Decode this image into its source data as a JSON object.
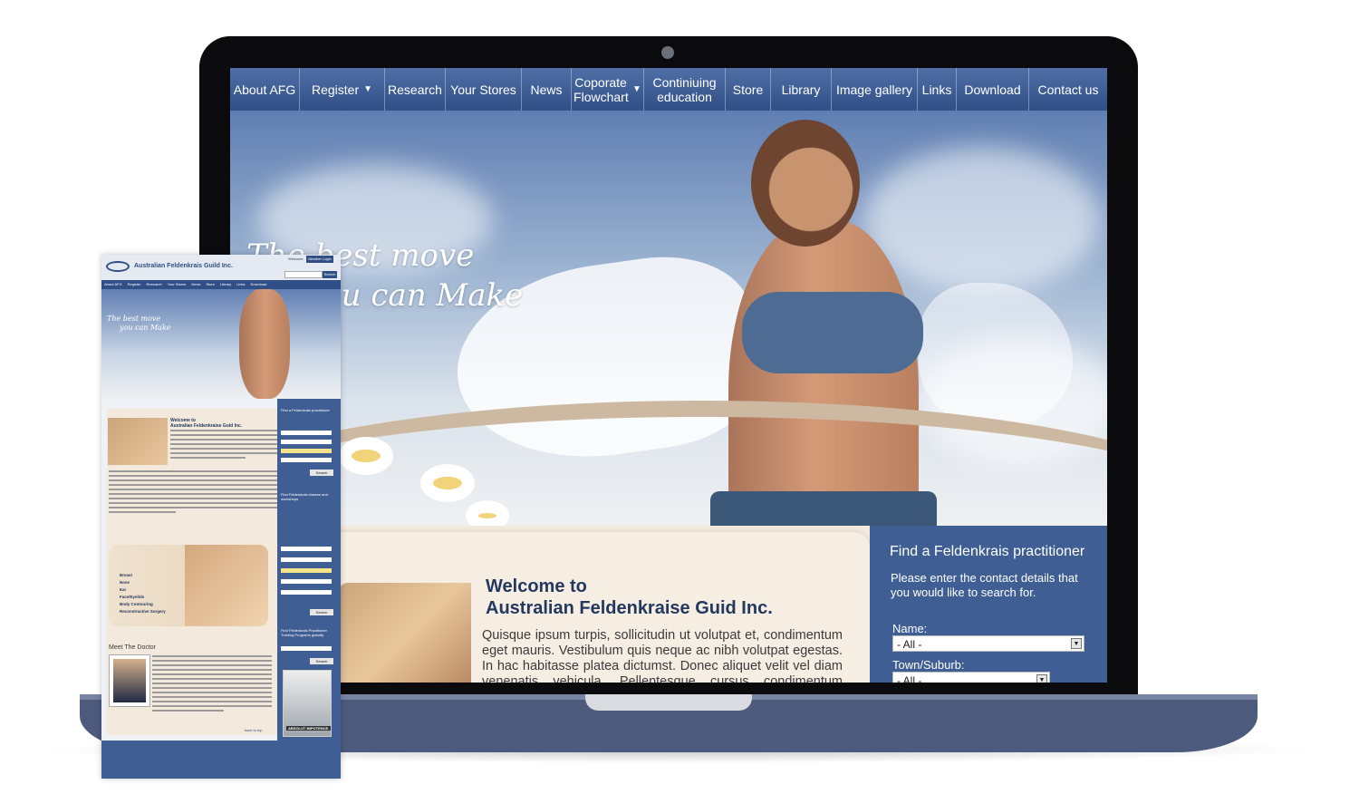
{
  "desktop": {
    "nav": [
      {
        "label": "About AFG",
        "dropdown": false
      },
      {
        "label": "Register",
        "dropdown": true
      },
      {
        "label": "Research",
        "dropdown": false
      },
      {
        "label": "Your Stores",
        "dropdown": false
      },
      {
        "label": "News",
        "dropdown": false
      },
      {
        "label": "Coporate Flowchart",
        "dropdown": true
      },
      {
        "label": "Continiuing education",
        "dropdown": false
      },
      {
        "label": "Store",
        "dropdown": false
      },
      {
        "label": "Library",
        "dropdown": false
      },
      {
        "label": "Image gallery",
        "dropdown": false
      },
      {
        "label": "Links",
        "dropdown": false
      },
      {
        "label": "Download",
        "dropdown": false
      },
      {
        "label": "Contact us",
        "dropdown": false
      }
    ],
    "hero": {
      "tagline_line1": "The best move",
      "tagline_line2": "you can Make"
    },
    "welcome": {
      "title_line1": "Welcome to",
      "title_line2": "Australian Feldenkraise Guid Inc.",
      "body": "Quisque ipsum turpis, sollicitudin ut volutpat et, condimentum eget mauris. Vestibulum quis neque ac nibh volutpat egestas. In hac habitasse platea dictumst. Donec aliquet velit vel diam venenatis vehicula. Pellentesque cursus condimentum tempus."
    },
    "sidebar": {
      "title": "Find a Feldenkrais practitioner",
      "description": "Please enter the contact details that you would like to search for.",
      "name_label": "Name:",
      "name_value": "- All -",
      "town_label": "Town/Suburb:",
      "town_value": "- All -"
    }
  },
  "mobile": {
    "site_name": "Australian Feldenkrais Guild Inc.",
    "welcome_text": "Welcome",
    "login_label": "Member Login",
    "search_label": "Search",
    "nav": [
      "About AFG",
      "Register",
      "Research",
      "Your Stores",
      "News",
      "Coporate Flowchart",
      "Continiuing education",
      "Store",
      "Library",
      "Image gallery",
      "Links",
      "Download",
      "Contact us"
    ],
    "tagline_line1": "The best move",
    "tagline_line2": "you can Make",
    "welcome_title_line1": "Welcome to",
    "welcome_title_line2": "Australian Feldenkraise Guid Inc.",
    "promo_items": [
      "Breast",
      "Nose",
      "Ear",
      "Face/Eyelids",
      "Body Contouring",
      "Reconstructive Surgery"
    ],
    "doctor_title": "Meet The Doctor",
    "back_to_top": "back to top",
    "side_title1": "Find a Feldenkrais practitioner",
    "side_title2": "Find Feldenkrais classes and workshops",
    "side_title3": "Find Feldenkrais Practitioner Training Programs globally",
    "search_button": "Search",
    "ad_caption": "ABSOLUT IMPOTENCE."
  }
}
